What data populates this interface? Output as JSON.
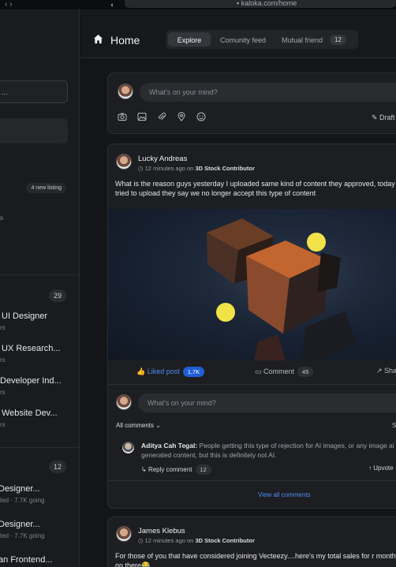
{
  "browser": {
    "url": "kaloka.com/home"
  },
  "sidebar": {
    "search_placeholder": "...",
    "badge_new_listing": "4 new listing",
    "partial_text_1": "s",
    "count_jobs": "29",
    "jobs": [
      {
        "title": "UI Designer",
        "sub": "rs"
      },
      {
        "title": "UX Research...",
        "sub": "rs"
      },
      {
        "title": "Developer Ind...",
        "sub": "rs"
      },
      {
        "title": "Website Dev...",
        "sub": "rs"
      }
    ],
    "count_groups": "12",
    "groups": [
      {
        "title": "Designer...",
        "sub": "ted · 7.7K going"
      },
      {
        "title": "Designer...",
        "sub": "ted · 7.7K going"
      },
      {
        "title": "an Frontend..."
      }
    ]
  },
  "header": {
    "title": "Home",
    "tabs": [
      "Explore",
      "Comunity feed",
      "Mutual friend"
    ],
    "mutual_count": "12"
  },
  "composer": {
    "placeholder": "What's on your mind?",
    "draft_label": "Draft",
    "tools": [
      "camera-icon",
      "image-icon",
      "attachment-icon",
      "location-icon",
      "emoji-icon"
    ]
  },
  "posts": [
    {
      "author": "Lucky Andreas",
      "time": "12 minutes ago on",
      "source": "3D Stock Contributor",
      "text": "What is the reason guys yesterday I uploaded same kind of content they approved, today I tried to upload they say we no longer accept this type of content",
      "like_label": "Liked post",
      "like_count": "1,7K",
      "comment_label": "Comment",
      "comment_count": "45",
      "share_label": "Share",
      "reply_placeholder": "What's on your mind?",
      "filter_label": "All comments",
      "sort_label": "So",
      "comment": {
        "author": "Aditya Cah Tegal:",
        "text": "People getting this type of rejection for AI images, or any image ai generated content, but this is definitely not AI.",
        "reply_label": "Reply comment",
        "reply_count": "12",
        "upvote_label": "Upvote"
      },
      "view_all": "View all comments"
    },
    {
      "author": "James Klebus",
      "time": "12 minutes ago on",
      "source": "3D Stock Contributor",
      "text": "For those of you that have considered joining Vecteezy....here's my total sales for r months on there😂"
    }
  ]
}
